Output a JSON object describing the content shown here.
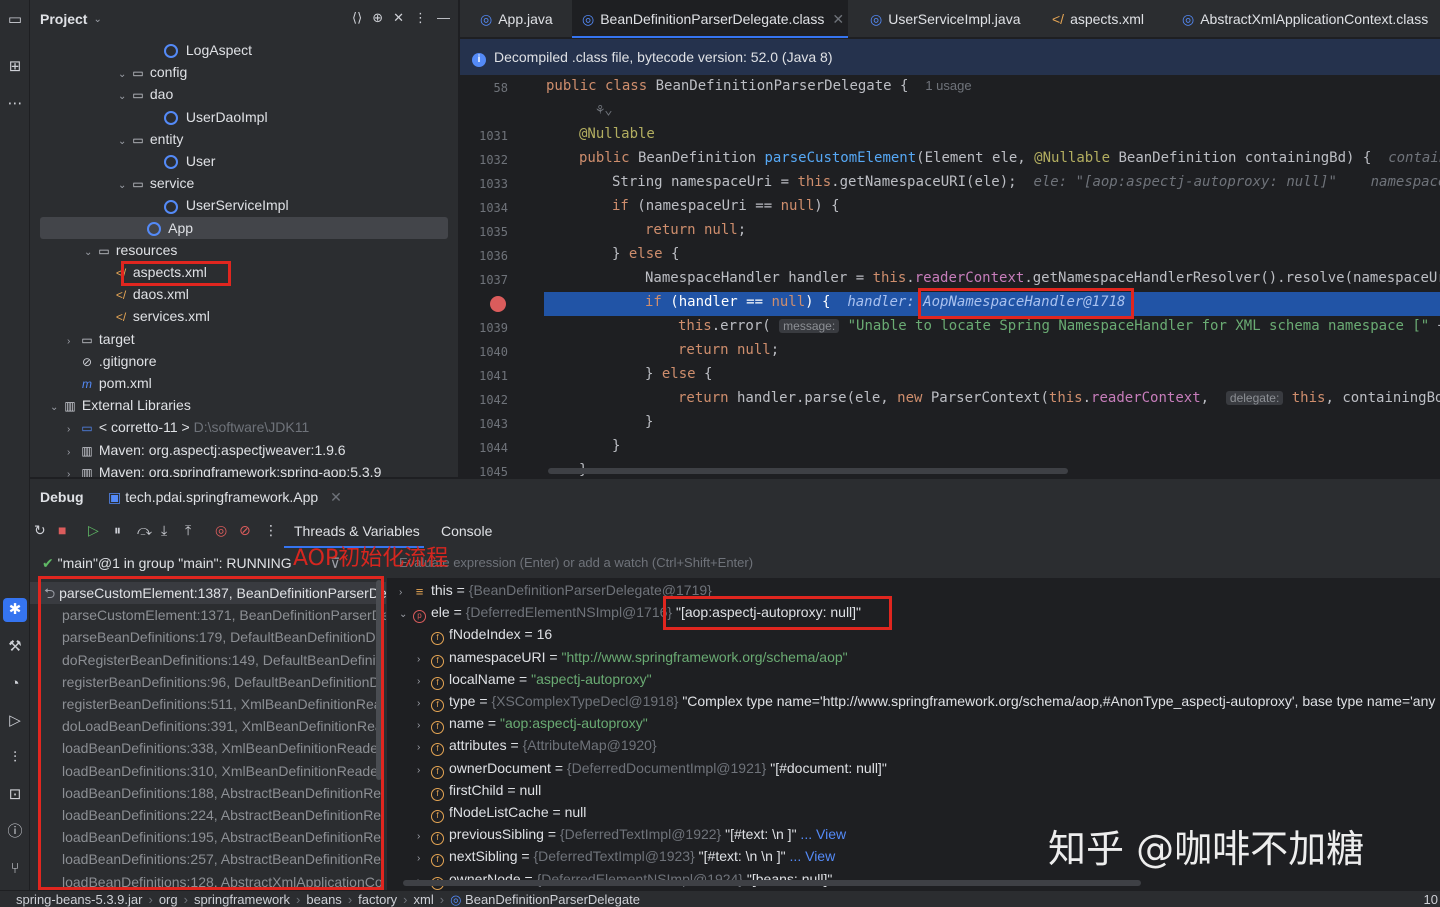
{
  "project": {
    "title": "Project",
    "tree": [
      {
        "label": "LogAspect",
        "kind": "class",
        "indent": 6,
        "chev": ""
      },
      {
        "label": "config",
        "kind": "folder",
        "indent": 4,
        "chev": "⌄"
      },
      {
        "label": "dao",
        "kind": "folder",
        "indent": 4,
        "chev": "⌄"
      },
      {
        "label": "UserDaoImpl",
        "kind": "class",
        "indent": 6,
        "chev": ""
      },
      {
        "label": "entity",
        "kind": "folder",
        "indent": 4,
        "chev": "⌄"
      },
      {
        "label": "User",
        "kind": "class",
        "indent": 6,
        "chev": ""
      },
      {
        "label": "service",
        "kind": "folder",
        "indent": 4,
        "chev": "⌄"
      },
      {
        "label": "UserServiceImpl",
        "kind": "class",
        "indent": 6,
        "chev": ""
      },
      {
        "label": "App",
        "kind": "class",
        "indent": 5,
        "chev": "",
        "selected": true
      },
      {
        "label": "resources",
        "kind": "folder",
        "indent": 2,
        "chev": "⌄"
      },
      {
        "label": "aspects.xml",
        "kind": "xml",
        "indent": 3,
        "chev": ""
      },
      {
        "label": "daos.xml",
        "kind": "xml",
        "indent": 3,
        "chev": ""
      },
      {
        "label": "services.xml",
        "kind": "xml",
        "indent": 3,
        "chev": ""
      },
      {
        "label": "target",
        "kind": "folder",
        "indent": 1,
        "chev": "›"
      },
      {
        "label": ".gitignore",
        "kind": "file",
        "indent": 1,
        "chev": ""
      },
      {
        "label": "pom.xml",
        "kind": "maven",
        "indent": 1,
        "chev": ""
      },
      {
        "label": "External Libraries",
        "kind": "lib",
        "indent": 0,
        "chev": "⌄"
      },
      {
        "label": "< corretto-11 >",
        "kind": "jdk",
        "indent": 1,
        "chev": "›",
        "extra": "D:\\software\\JDK11"
      },
      {
        "label": "Maven: org.aspectj:aspectjweaver:1.9.6",
        "kind": "lib",
        "indent": 1,
        "chev": "›"
      },
      {
        "label": "Maven: org.springframework:spring-aop:5.3.9",
        "kind": "lib",
        "indent": 1,
        "chev": "›"
      }
    ]
  },
  "tabs": [
    {
      "label": "App.java",
      "active": false,
      "close": false
    },
    {
      "label": "BeanDefinitionParserDelegate.class",
      "active": true,
      "close": true
    },
    {
      "label": "UserServiceImpl.java",
      "active": false,
      "close": false
    },
    {
      "label": "aspects.xml",
      "active": false,
      "close": false
    },
    {
      "label": "AbstractXmlApplicationContext.class",
      "active": false,
      "close": false
    }
  ],
  "banner": "Decompiled .class file, bytecode version: 52.0 (Java 8)",
  "editor": {
    "lines": [
      {
        "n": "58",
        "html": "<span class=\"kw\">public class</span> BeanDefinitionParserDelegate {  <span class=\"hint\" style=\"font-style:normal;font-family:'Liberation Sans',sans-serif;font-size:13px\">1 usage</span>",
        "indent": 0
      },
      {
        "n": "",
        "html": "<span class=\"hint\" style=\"font-style:normal\">  ⚘⌄</span>",
        "indent": 1
      },
      {
        "n": "1031",
        "html": "<span class=\"an\">@Nullable</span>",
        "indent": 1
      },
      {
        "n": "1032",
        "html": "<span class=\"kw\">public</span> BeanDefinition <span class=\"fn\">parseCustomElement</span>(Element ele, <span class=\"an\">@Nullable</span> BeanDefinition containingBd) {  <span class=\"hint\">contain</span>",
        "indent": 1
      },
      {
        "n": "1033",
        "html": "String namespaceUri = <span class=\"kw\">this</span>.getNamespaceURI(ele);  <span class=\"hint\">ele: \"[aop:aspectj-autoproxy: null]\"    namespace</span>",
        "indent": 2
      },
      {
        "n": "1034",
        "html": "<span class=\"kw\">if</span> (namespaceUri == <span class=\"kw\">null</span>) {",
        "indent": 2
      },
      {
        "n": "1035",
        "html": "<span class=\"kw\">return null</span>;",
        "indent": 3
      },
      {
        "n": "1036",
        "html": "} <span class=\"kw\">else</span> {",
        "indent": 2
      },
      {
        "n": "1037",
        "html": "NamespaceHandler handler = <span class=\"kw\">this</span>.<span class=\"fd\">readerContext</span>.getNamespaceHandlerResolver().resolve(namespaceUr",
        "indent": 3
      },
      {
        "n": "",
        "html": "<span class=\"kw\">if</span> (handler == <span class=\"kw\">null</span>) {  <span class=\"hint\" style=\"color:#a9c1ef\">handler: AopNamespaceHandler@1718</span>",
        "indent": 3,
        "hl": true
      },
      {
        "n": "1039",
        "html": "<span class=\"kw\">this</span>.error( <span class=\"param\">message:</span> <span class=\"st\">\"Unable to locate Spring NamespaceHandler for XML schema namespace [\"</span> +",
        "indent": 4
      },
      {
        "n": "1040",
        "html": "<span class=\"kw\">return null</span>;",
        "indent": 4
      },
      {
        "n": "1041",
        "html": "} <span class=\"kw\">else</span> {",
        "indent": 3
      },
      {
        "n": "1042",
        "html": "<span class=\"kw\">return</span> handler.parse(ele, <span class=\"kw\">new</span> ParserContext(<span class=\"kw\">this</span>.<span class=\"fd\">readerContext</span>,  <span class=\"param\">delegate:</span> <span class=\"kw\">this</span>, containingBd)",
        "indent": 4
      },
      {
        "n": "1043",
        "html": "}",
        "indent": 3
      },
      {
        "n": "1044",
        "html": "}",
        "indent": 2
      },
      {
        "n": "1045",
        "html": "}",
        "indent": 1
      }
    ]
  },
  "debug": {
    "title": "Debug",
    "session": "tech.pdai.springframework.App",
    "tab_threads": "Threads & Variables",
    "tab_console": "Console",
    "thread": "\"main\"@1 in group \"main\": RUNNING",
    "overlay_title": "AOP初始化流程",
    "eval_placeholder": "Evaluate expression (Enter) or add a watch (Ctrl+Shift+Enter)",
    "frames": [
      "parseCustomElement:1387, BeanDefinitionParserDe",
      "parseCustomElement:1371, BeanDefinitionParserDe",
      "parseBeanDefinitions:179, DefaultBeanDefinitionDo",
      "doRegisterBeanDefinitions:149, DefaultBeanDefiniti",
      "registerBeanDefinitions:96, DefaultBeanDefinitionD",
      "registerBeanDefinitions:511, XmlBeanDefinitionRea",
      "doLoadBeanDefinitions:391, XmlBeanDefinitionRea",
      "loadBeanDefinitions:338, XmlBeanDefinitionReader",
      "loadBeanDefinitions:310, XmlBeanDefinitionReader",
      "loadBeanDefinitions:188, AbstractBeanDefinitionRe",
      "loadBeanDefinitions:224, AbstractBeanDefinitionRe",
      "loadBeanDefinitions:195, AbstractBeanDefinitionRe",
      "loadBeanDefinitions:257, AbstractBeanDefinitionRe",
      "loadBeanDefinitions:128, AbstractXmlApplicationCo"
    ],
    "variables": [
      {
        "name": "this",
        "type": "{BeanDefinitionParserDelegate@1719}",
        "val": "",
        "chev": "›",
        "icon": "≡",
        "lvl": 0
      },
      {
        "name": "ele",
        "type": "{DeferredElementNSImpl@1716}",
        "val": "\"[aop:aspectj-autoproxy: null]\"",
        "chev": "⌄",
        "icon": "p",
        "lvl": 0
      },
      {
        "name": "fNodeIndex",
        "type": "",
        "val": "16",
        "chev": "",
        "icon": "f",
        "lvl": 1
      },
      {
        "name": "namespaceURI",
        "type": "",
        "val": "\"http://www.springframework.org/schema/aop\"",
        "chev": "›",
        "icon": "f",
        "lvl": 1,
        "str": true
      },
      {
        "name": "localName",
        "type": "",
        "val": "\"aspectj-autoproxy\"",
        "chev": "›",
        "icon": "f",
        "lvl": 1,
        "str": true
      },
      {
        "name": "type",
        "type": "{XSComplexTypeDecl@1918}",
        "val": "\"Complex type name='http://www.springframework.org/schema/aop,#AnonType_aspectj-autoproxy',  base type name='any",
        "chev": "›",
        "icon": "f",
        "lvl": 1
      },
      {
        "name": "name",
        "type": "",
        "val": "\"aop:aspectj-autoproxy\"",
        "chev": "›",
        "icon": "f",
        "lvl": 1,
        "str": true
      },
      {
        "name": "attributes",
        "type": "{AttributeMap@1920}",
        "val": "",
        "chev": "›",
        "icon": "f",
        "lvl": 1
      },
      {
        "name": "ownerDocument",
        "type": "{DeferredDocumentImpl@1921}",
        "val": "\"[#document: null]\"",
        "chev": "›",
        "icon": "f",
        "lvl": 1
      },
      {
        "name": "firstChild",
        "type": "",
        "val": "null",
        "chev": "",
        "icon": "f",
        "lvl": 1
      },
      {
        "name": "fNodeListCache",
        "type": "",
        "val": "null",
        "chev": "",
        "icon": "f",
        "lvl": 1
      },
      {
        "name": "previousSibling",
        "type": "{DeferredTextImpl@1922}",
        "val": "\"[#text: \\n    ]\"",
        "chev": "›",
        "icon": "f",
        "lvl": 1,
        "link": "... View"
      },
      {
        "name": "nextSibling",
        "type": "{DeferredTextImpl@1923}",
        "val": "\"[#text: \\n    \\n    ]\"",
        "chev": "›",
        "icon": "f",
        "lvl": 1,
        "link": "... View"
      },
      {
        "name": "ownerNode",
        "type": "{DeferredElementNSImpl@1924}",
        "val": "\"[beans: null]\"",
        "chev": "›",
        "icon": "f",
        "lvl": 1
      }
    ]
  },
  "statusbar": [
    "spring-beans-5.3.9.jar",
    "org",
    "springframework",
    "beans",
    "factory",
    "xml",
    "BeanDefinitionParserDelegate"
  ],
  "statusbar_right": "10",
  "watermark": "知乎 @咖啡不加糖",
  "colors": {
    "accent": "#3574f0",
    "highlight": "#e0261f"
  }
}
